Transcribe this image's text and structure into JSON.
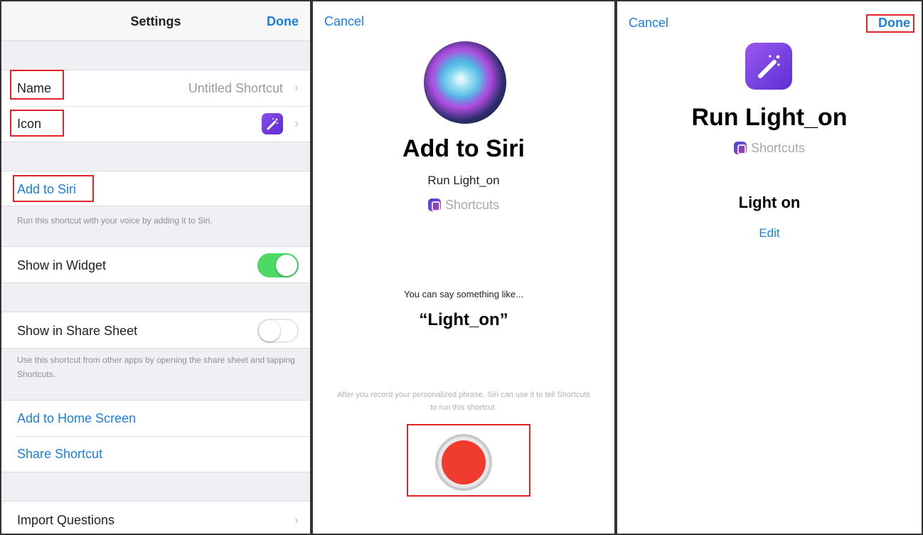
{
  "settings": {
    "title": "Settings",
    "done_label": "Done",
    "name_label": "Name",
    "name_value": "Untitled Shortcut",
    "icon_label": "Icon",
    "add_to_siri_label": "Add to Siri",
    "add_to_siri_footnote": "Run this shortcut with your voice by adding it to Siri.",
    "show_in_widget_label": "Show in Widget",
    "show_in_widget_on": true,
    "show_in_share_sheet_label": "Show in Share Sheet",
    "show_in_share_sheet_on": false,
    "share_sheet_footnote": "Use this shortcut from other apps by opening the share sheet and tapping Shortcuts.",
    "add_home_screen_label": "Add to Home Screen",
    "share_shortcut_label": "Share Shortcut",
    "import_questions_label": "Import Questions",
    "chevron": "›"
  },
  "add_siri": {
    "cancel_label": "Cancel",
    "title": "Add to Siri",
    "shortcut_name": "Run Light_on",
    "app_name": "Shortcuts",
    "say_hint": "You can say something like...",
    "phrase": "“Light_on”",
    "record_info": "After you record your personalized phrase, Siri can use it to tell Shortcuts to run this shortcut.",
    "icons": {
      "orb": "siri-orb-icon",
      "record": "record-icon"
    }
  },
  "confirm": {
    "cancel_label": "Cancel",
    "done_label": "Done",
    "title": "Run Light_on",
    "app_name": "Shortcuts",
    "phrase": "Light on",
    "edit_label": "Edit",
    "icons": {
      "shortcut": "magic-wand-icon"
    }
  },
  "colors": {
    "accent_blue": "#1a7fe0",
    "highlight_red": "#e0242a",
    "toggle_green": "#4cd964",
    "record_red": "#f03c2e"
  }
}
